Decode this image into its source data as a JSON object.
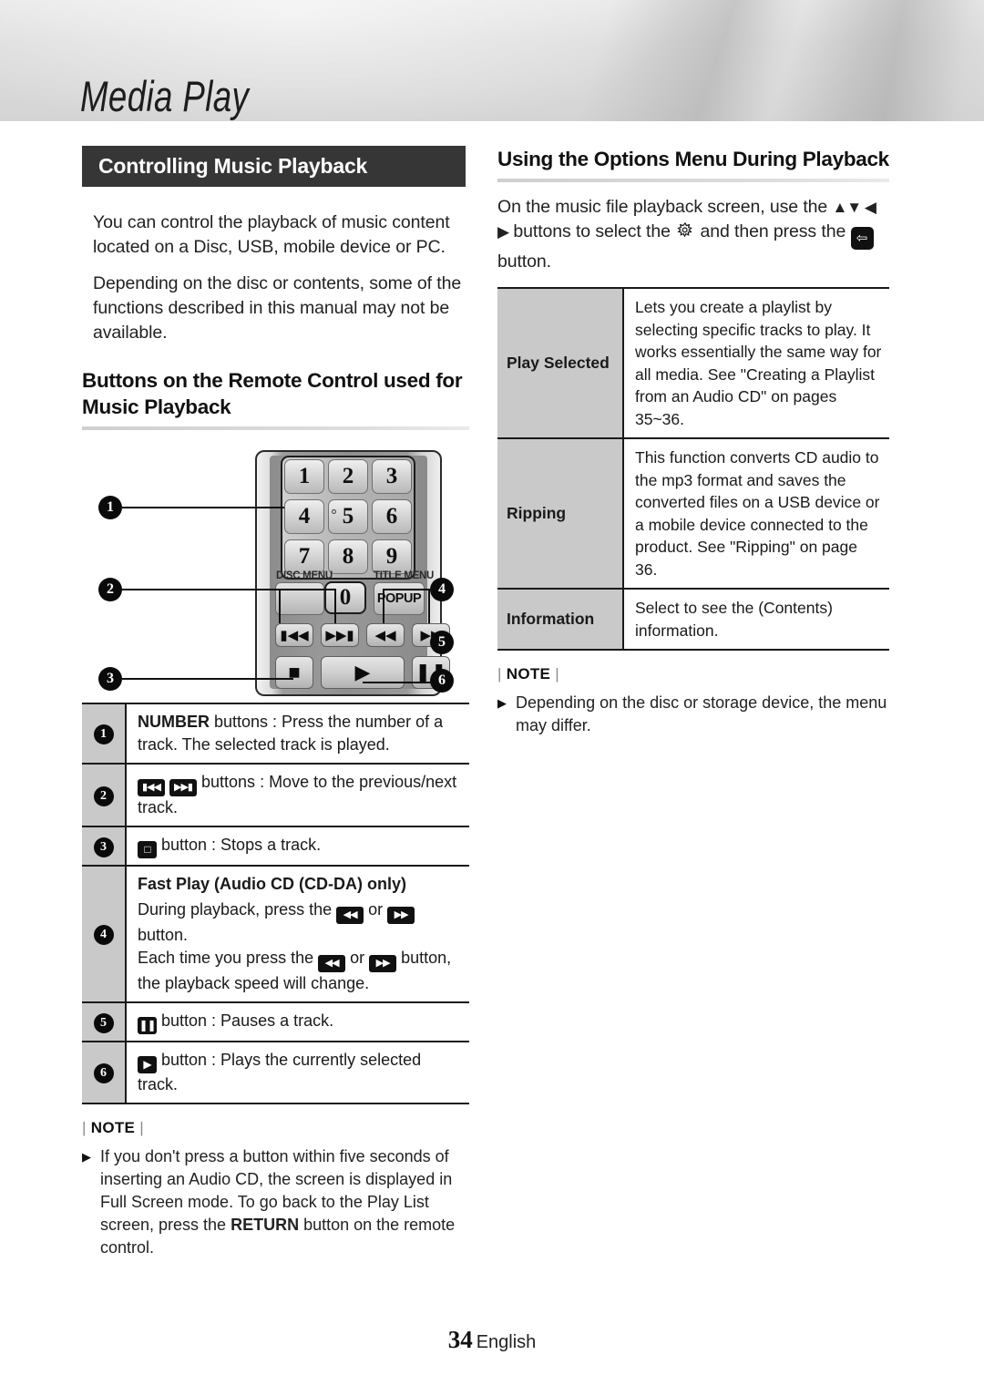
{
  "header": {
    "chapter_title": "Media Play"
  },
  "left": {
    "section_bar": "Controlling Music Playback",
    "intro_p1": "You can control the playback of music content located on a Disc, USB, mobile device or PC.",
    "intro_p2": "Depending on the disc or contents, some of the functions described in this manual may not be available.",
    "subhead": "Buttons on the Remote Control used for Music Playback",
    "remote": {
      "numbers": [
        "1",
        "2",
        "3",
        "4",
        "5",
        "6",
        "7",
        "8",
        "9"
      ],
      "zero": "0",
      "disc_menu_label": "DISC MENU",
      "title_menu_label": "TITLE MENU",
      "popup_label": "POPUP",
      "callouts": [
        "1",
        "2",
        "3",
        "4",
        "5",
        "6"
      ]
    },
    "table": {
      "rows": [
        {
          "num": "1",
          "text_pre": "",
          "bold": "NUMBER",
          "text_post": " buttons : Press the number of a track. The selected track is played."
        },
        {
          "num": "2",
          "text": " buttons : Move to the previous/next track."
        },
        {
          "num": "3",
          "text": " button : Stops a track."
        },
        {
          "num": "4",
          "title": "Fast Play (Audio CD (CD-DA) only)",
          "line1_a": "During playback, press the ",
          "line1_b": " or ",
          "line1_c": " button.",
          "line2_a": "Each time you press the ",
          "line2_b": " or ",
          "line2_c": " button, the playback speed will change."
        },
        {
          "num": "5",
          "text": " button : Pauses a track."
        },
        {
          "num": "6",
          "text": " button : Plays the currently selected track."
        }
      ]
    },
    "note": {
      "label": "NOTE",
      "item_a": "If you don't press a button within five seconds of inserting an Audio CD, the screen is displayed in Full Screen mode. To go back to the Play List screen, press the ",
      "item_bold": "RETURN",
      "item_b": " button on the remote control."
    }
  },
  "right": {
    "subhead": "Using the Options Menu During Playback",
    "intro_a": "On the music file playback screen, use the ",
    "intro_arrows": "▲▼ ◀ ▶",
    "intro_b": " buttons to select the ",
    "intro_c": " and then press the ",
    "intro_d": " button.",
    "table": {
      "rows": [
        {
          "name": "Play Selected",
          "desc": "Lets you create a playlist by selecting specific tracks to play. It works essentially the same way for all media. See \"Creating a Playlist from an Audio CD\" on pages 35~36."
        },
        {
          "name": "Ripping",
          "desc": "This function converts CD audio to the mp3 format and saves the converted files on a USB device or a mobile device connected to the product. See \"Ripping\" on page 36."
        },
        {
          "name": "Information",
          "desc": "Select to see the (Contents) information."
        }
      ]
    },
    "note": {
      "label": "NOTE",
      "item": "Depending on the disc or storage device, the menu may differ."
    }
  },
  "footer": {
    "page_number": "34",
    "language": "English"
  }
}
